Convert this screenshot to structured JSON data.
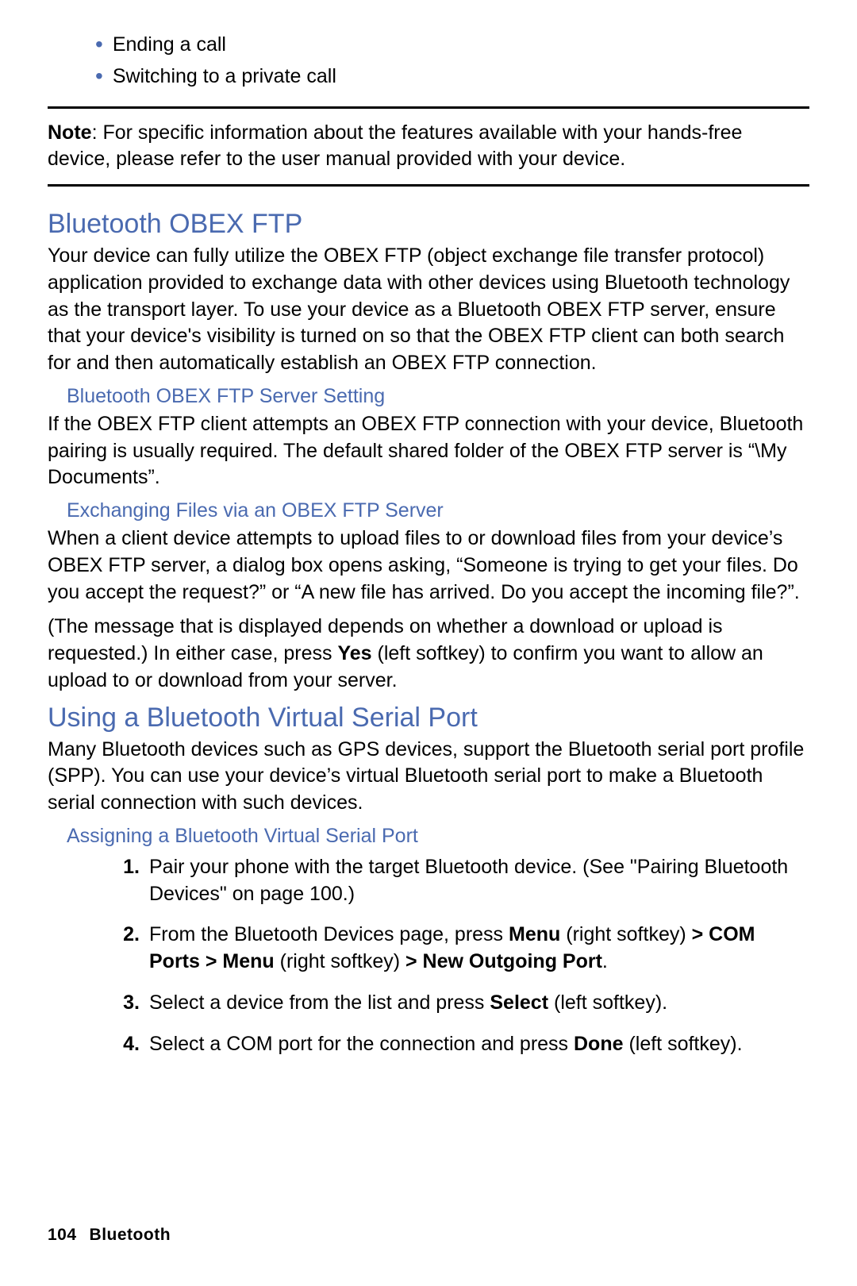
{
  "bullets": {
    "item1": "Ending a call",
    "item2": "Switching to a private call"
  },
  "note": {
    "label": "Note",
    "text": ": For specific information about the features available with your hands-free device, please refer to the user manual provided with your device."
  },
  "section1": {
    "heading": "Bluetooth OBEX FTP",
    "para": "Your device can fully utilize the OBEX FTP (object exchange file transfer protocol) application provided to exchange data with other devices using Bluetooth technology as the transport layer. To use your device as a Bluetooth OBEX FTP server, ensure that your device's visibility is turned on so that the OBEX FTP client can both search for and then automatically establish an OBEX FTP connection."
  },
  "sub1": {
    "heading": "Bluetooth OBEX FTP Server Setting",
    "para": "If the OBEX FTP client attempts an OBEX FTP connection with your device, Bluetooth pairing is usually required. The default shared folder of the OBEX FTP server is “\\My Documents”."
  },
  "sub2": {
    "heading": "Exchanging Files via an OBEX FTP Server",
    "para1": "When a client device attempts to upload files to or download files from your device’s OBEX FTP server, a dialog box opens asking, “Someone is trying to get your files. Do you accept the request?” or “A new file has arrived. Do you accept the incoming file?”.",
    "para2_a": "(The message that is displayed depends on whether a download or upload is requested.) In either case, press ",
    "para2_bold": "Yes",
    "para2_b": " (left softkey) to confirm you want to allow an upload to or download from your server."
  },
  "section2": {
    "heading": "Using a Bluetooth Virtual Serial Port",
    "para": "Many Bluetooth devices such as GPS devices, support the Bluetooth serial port profile (SPP). You can use your device’s virtual Bluetooth serial port to make a Bluetooth serial connection with such devices."
  },
  "sub3": {
    "heading": "Assigning a Bluetooth Virtual Serial Port",
    "steps": {
      "n1": "1.",
      "s1": "Pair your phone with the target Bluetooth device. (See \"Pairing Bluetooth Devices\" on page 100.)",
      "n2": "2.",
      "s2_a": "From the Bluetooth Devices page, press ",
      "s2_b1": "Menu",
      "s2_c": " (right softkey) ",
      "s2_b2": "> COM Ports > Menu",
      "s2_d": " (right softkey) ",
      "s2_b3": "> New Outgoing Port",
      "s2_e": ".",
      "n3": "3.",
      "s3_a": "Select a device from the list and press ",
      "s3_b": "Select",
      "s3_c": " (left softkey).",
      "n4": "4.",
      "s4_a": "Select a COM port for the connection and press ",
      "s4_b": "Done",
      "s4_c": " (left softkey)."
    }
  },
  "footer": {
    "page": "104",
    "section": "Bluetooth"
  }
}
